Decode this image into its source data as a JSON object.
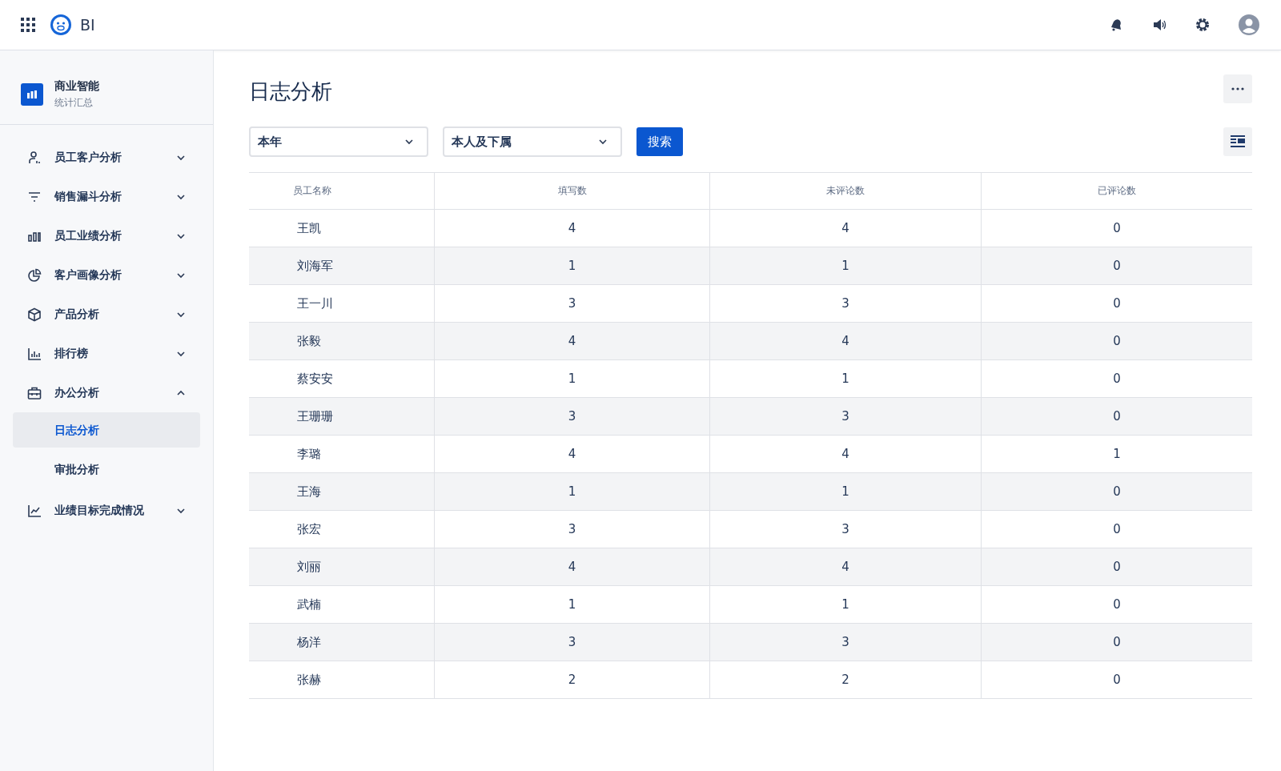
{
  "topbar": {
    "app_name": "BI"
  },
  "sidebar": {
    "title": "商业智能",
    "subtitle": "统计汇总",
    "items": [
      {
        "kind": "user",
        "label": "员工客户分析",
        "expanded": false
      },
      {
        "kind": "filter",
        "label": "销售漏斗分析",
        "expanded": false
      },
      {
        "kind": "bars",
        "label": "员工业绩分析",
        "expanded": false
      },
      {
        "kind": "pie",
        "label": "客户画像分析",
        "expanded": false
      },
      {
        "kind": "box",
        "label": "产品分析",
        "expanded": false
      },
      {
        "kind": "chart",
        "label": "排行榜",
        "expanded": false
      },
      {
        "kind": "briefcase",
        "label": "办公分析",
        "expanded": true,
        "children": [
          {
            "label": "日志分析",
            "selected": true
          },
          {
            "label": "审批分析",
            "selected": false
          }
        ]
      },
      {
        "kind": "trend",
        "label": "业绩目标完成情况",
        "expanded": false
      }
    ]
  },
  "page": {
    "title": "日志分析"
  },
  "filters": {
    "period": "本年",
    "scope": "本人及下属",
    "search_button": "搜索"
  },
  "table": {
    "columns": [
      "员工名称",
      "填写数",
      "未评论数",
      "已评论数"
    ],
    "rows": [
      [
        "王凯",
        "4",
        "4",
        "0"
      ],
      [
        "刘海军",
        "1",
        "1",
        "0"
      ],
      [
        "王一川",
        "3",
        "3",
        "0"
      ],
      [
        "张毅",
        "4",
        "4",
        "0"
      ],
      [
        "蔡安安",
        "1",
        "1",
        "0"
      ],
      [
        "王珊珊",
        "3",
        "3",
        "0"
      ],
      [
        "李璐",
        "4",
        "4",
        "1"
      ],
      [
        "王海",
        "1",
        "1",
        "0"
      ],
      [
        "张宏",
        "3",
        "3",
        "0"
      ],
      [
        "刘丽",
        "4",
        "4",
        "0"
      ],
      [
        "武楠",
        "1",
        "1",
        "0"
      ],
      [
        "杨洋",
        "3",
        "3",
        "0"
      ],
      [
        "张赫",
        "2",
        "2",
        "0"
      ]
    ]
  }
}
